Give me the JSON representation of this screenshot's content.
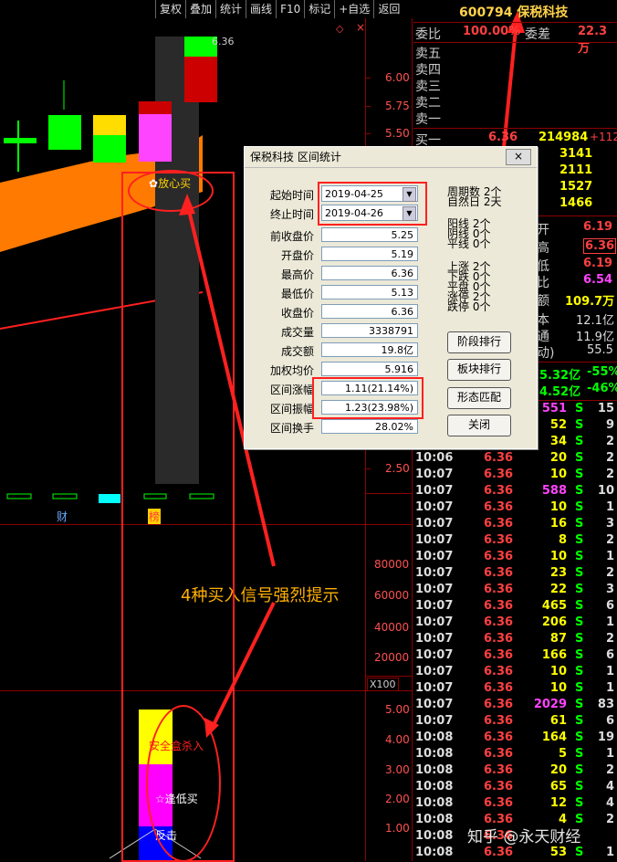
{
  "toolbar": [
    "复权",
    "叠加",
    "统计",
    "画线",
    "F10",
    "标记",
    "+自选",
    "返回"
  ],
  "stock": {
    "code": "600794",
    "name": "保税科技"
  },
  "price_axis": [
    "6.00",
    "5.75",
    "5.50",
    "2.50"
  ],
  "volume_axis": [
    "80000",
    "60000",
    "40000",
    "20000"
  ],
  "volume_unit": "X100",
  "indicator_axis": [
    "5.00",
    "4.00",
    "3.00",
    "2.00",
    "1.00"
  ],
  "current_price_label": "6.36",
  "signals": {
    "fangxin": "放心买",
    "anquan": "安全盒杀入",
    "dijia": "☆逢低买",
    "fanji": "反击",
    "cai": "财",
    "bang": "榜",
    "annotation": "4种买入信号强烈提示"
  },
  "orderbook": {
    "weibi_label": "委比",
    "weibi_val": "100.00%",
    "weicha_label": "委差",
    "weicha_val": "22.3万",
    "sells": [
      "卖五",
      "卖四",
      "卖三",
      "卖二",
      "卖一"
    ],
    "buys": [
      {
        "label": "买一",
        "price": "6.36",
        "vol": "214984",
        "chg": "+112"
      },
      {
        "label": "买二",
        "price": "",
        "vol": "3141",
        "chg": ""
      },
      {
        "label": "买三",
        "price": "",
        "vol": "2111",
        "chg": ""
      },
      {
        "label": "买四",
        "price": "",
        "vol": "1527",
        "chg": ""
      },
      {
        "label": "买五",
        "price": "",
        "vol": "1466",
        "chg": ""
      }
    ]
  },
  "quote": [
    {
      "label": "开",
      "val": "6.19"
    },
    {
      "label": "高",
      "val": "6.36"
    },
    {
      "label": "低",
      "val": "6.19"
    },
    {
      "label": "比",
      "val": "6.54"
    },
    {
      "label": "额",
      "val": "109.7万"
    },
    {
      "label": "本",
      "val": "12.1亿"
    },
    {
      "label": "通",
      "val": "11.9亿"
    },
    {
      "label": "动)",
      "val": "55.5"
    }
  ],
  "flows": [
    {
      "val": "5.32亿",
      "pct": "-55%"
    },
    {
      "val": "4.52亿",
      "pct": "-46%"
    }
  ],
  "ticks": [
    {
      "t": "",
      "p": "",
      "v": "551",
      "s": "S",
      "n": "15"
    },
    {
      "t": "",
      "p": "",
      "v": "52",
      "s": "S",
      "n": "9"
    },
    {
      "t": "",
      "p": "",
      "v": "34",
      "s": "S",
      "n": "2"
    },
    {
      "t": "10:06",
      "p": "6.36",
      "v": "20",
      "s": "S",
      "n": "2"
    },
    {
      "t": "10:07",
      "p": "6.36",
      "v": "10",
      "s": "S",
      "n": "2"
    },
    {
      "t": "10:07",
      "p": "6.36",
      "v": "588",
      "s": "S",
      "n": "10"
    },
    {
      "t": "10:07",
      "p": "6.36",
      "v": "10",
      "s": "S",
      "n": "1"
    },
    {
      "t": "10:07",
      "p": "6.36",
      "v": "16",
      "s": "S",
      "n": "3"
    },
    {
      "t": "10:07",
      "p": "6.36",
      "v": "8",
      "s": "S",
      "n": "2"
    },
    {
      "t": "10:07",
      "p": "6.36",
      "v": "10",
      "s": "S",
      "n": "1"
    },
    {
      "t": "10:07",
      "p": "6.36",
      "v": "23",
      "s": "S",
      "n": "2"
    },
    {
      "t": "10:07",
      "p": "6.36",
      "v": "22",
      "s": "S",
      "n": "3"
    },
    {
      "t": "10:07",
      "p": "6.36",
      "v": "465",
      "s": "S",
      "n": "6"
    },
    {
      "t": "10:07",
      "p": "6.36",
      "v": "206",
      "s": "S",
      "n": "1"
    },
    {
      "t": "10:07",
      "p": "6.36",
      "v": "87",
      "s": "S",
      "n": "2"
    },
    {
      "t": "10:07",
      "p": "6.36",
      "v": "166",
      "s": "S",
      "n": "6"
    },
    {
      "t": "10:07",
      "p": "6.36",
      "v": "10",
      "s": "S",
      "n": "1"
    },
    {
      "t": "10:07",
      "p": "6.36",
      "v": "10",
      "s": "S",
      "n": "1"
    },
    {
      "t": "10:07",
      "p": "6.36",
      "v": "2029",
      "s": "S",
      "n": "83"
    },
    {
      "t": "10:07",
      "p": "6.36",
      "v": "61",
      "s": "S",
      "n": "6"
    },
    {
      "t": "10:08",
      "p": "6.36",
      "v": "164",
      "s": "S",
      "n": "19"
    },
    {
      "t": "10:08",
      "p": "6.36",
      "v": "5",
      "s": "S",
      "n": "1"
    },
    {
      "t": "10:08",
      "p": "6.36",
      "v": "20",
      "s": "S",
      "n": "2"
    },
    {
      "t": "10:08",
      "p": "6.36",
      "v": "65",
      "s": "S",
      "n": "4"
    },
    {
      "t": "10:08",
      "p": "6.36",
      "v": "12",
      "s": "S",
      "n": "4"
    },
    {
      "t": "10:08",
      "p": "6.36",
      "v": "4",
      "s": "S",
      "n": "2"
    },
    {
      "t": "10:08",
      "p": "6.36",
      "v": "",
      "s": "",
      "n": ""
    },
    {
      "t": "10:08",
      "p": "6.36",
      "v": "53",
      "s": "S",
      "n": "1"
    }
  ],
  "watermark": "知乎 @永天财经",
  "dialog": {
    "title": "保税科技 区间统计",
    "close": "×",
    "start_label": "起始时间",
    "start_val": "2019-04-25",
    "end_label": "终止时间",
    "end_val": "2019-04-26",
    "fields": [
      {
        "label": "前收盘价",
        "val": "5.25"
      },
      {
        "label": "开盘价",
        "val": "5.19"
      },
      {
        "label": "最高价",
        "val": "6.36"
      },
      {
        "label": "最低价",
        "val": "5.13"
      },
      {
        "label": "收盘价",
        "val": "6.36"
      },
      {
        "label": "成交量",
        "val": "3338791"
      },
      {
        "label": "成交额",
        "val": "19.8亿"
      },
      {
        "label": "加权均价",
        "val": "5.916"
      },
      {
        "label": "区间涨幅",
        "val": "1.11(21.14%)"
      },
      {
        "label": "区间振幅",
        "val": "1.23(23.98%)"
      },
      {
        "label": "区间换手",
        "val": "28.02%"
      }
    ],
    "stats1": [
      "周期数 2个",
      "自然日 2天"
    ],
    "stats2": [
      "阳线 2个",
      "阴线 0个",
      "平线 0个"
    ],
    "stats3": [
      "上涨 2个",
      "下跌 0个",
      "平盘 0个",
      "涨停 2个",
      "跌停 0个"
    ],
    "buttons": [
      "阶段排行",
      "板块排行",
      "形态匹配",
      "关闭"
    ]
  }
}
